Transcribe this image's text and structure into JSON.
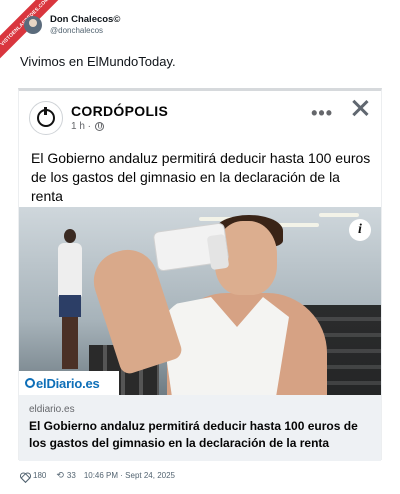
{
  "ribbon": {
    "text": "VISTOENLASREDES.COM"
  },
  "tweet": {
    "display_name": "Don Chalecos©",
    "handle": "@donchalecos",
    "text": "Vivimos en ElMundoToday.",
    "likes": "180",
    "retweets": "33",
    "timestamp": "10:46 PM · Sept 24, 2025"
  },
  "fb_post": {
    "page_name": "CORDÓPOLIS",
    "time": "1 h ·",
    "more_icon": "•••",
    "text": "El Gobierno andaluz permitirá deducir hasta 100 euros de los gastos del gimnasio en la declaración de la renta",
    "info_icon": "i",
    "brand": "elDiario.es",
    "link_domain": "eldiario.es",
    "link_title": "El Gobierno andaluz permitirá deducir hasta 100 euros de los gastos del gimnasio en la declaración de la renta"
  },
  "colors": {
    "accent": "#0e6fb8",
    "ribbon": "#d9363e"
  }
}
